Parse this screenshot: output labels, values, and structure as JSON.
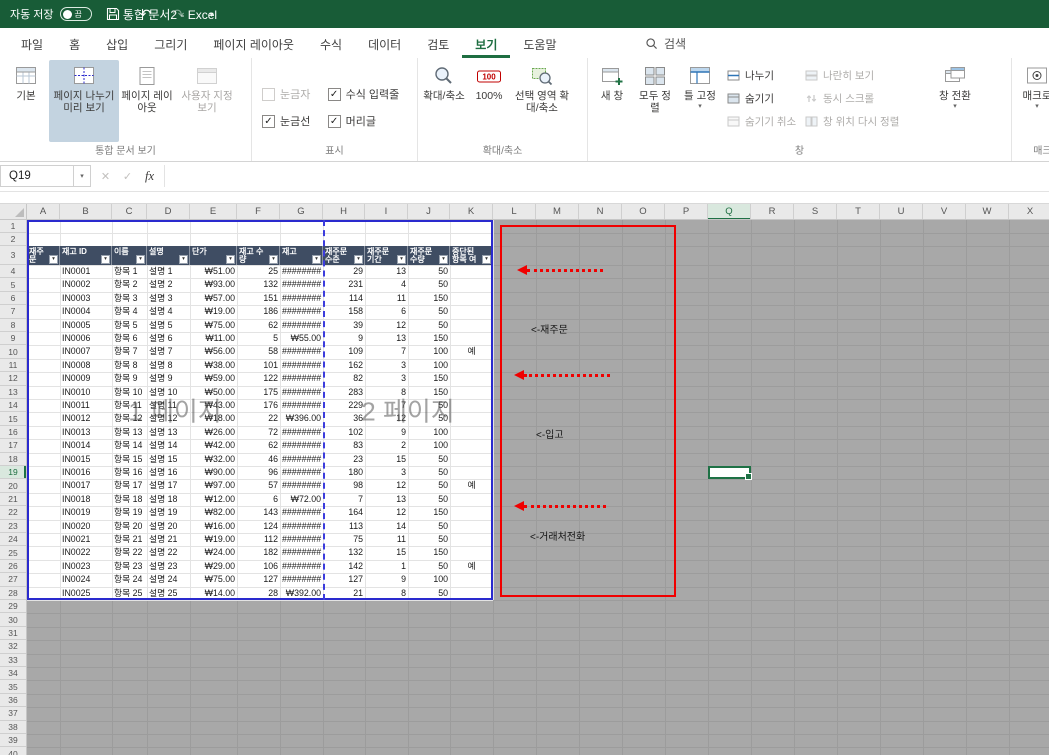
{
  "titlebar": {
    "autosave_label": "자동 저장",
    "autosave_state": "끔",
    "doc_title": "통합 문서2 - Excel"
  },
  "tabs": {
    "items": [
      "파일",
      "홈",
      "삽입",
      "그리기",
      "페이지 레이아웃",
      "수식",
      "데이터",
      "검토",
      "보기",
      "도움말"
    ],
    "active": "보기",
    "search_label": "검색"
  },
  "ribbon": {
    "views": {
      "group_label": "통합 문서 보기",
      "normal": "기본",
      "page_break_preview": "페이지 나누기 미리 보기",
      "page_layout": "페이지 레이아웃",
      "custom_views": "사용자 지정 보기"
    },
    "show": {
      "group_label": "표시",
      "ruler": "눈금자",
      "formula_bar": "수식 입력줄",
      "gridlines": "눈금선",
      "headings": "머리글"
    },
    "zoom": {
      "group_label": "확대/축소",
      "zoom": "확대/축소",
      "hundred": "100%",
      "zoom_selection": "선택 영역 확대/축소"
    },
    "window": {
      "group_label": "창",
      "new_window": "새 창",
      "arrange_all": "모두 정렬",
      "freeze_panes": "틀 고정",
      "split": "나누기",
      "hide": "숨기기",
      "unhide": "숨기기 취소",
      "side_by_side": "나란히 보기",
      "sync_scroll": "동시 스크롤",
      "reset_position": "창 위치 다시 정렬",
      "switch_windows": "창 전환"
    },
    "macros": {
      "group_label": "매크로",
      "macros": "매크로"
    }
  },
  "formula_bar": {
    "name_box": "Q19",
    "fx_label": "fx"
  },
  "sheet": {
    "selected_cell": "Q19",
    "selected_col": "Q",
    "selected_row": 19,
    "col_letters": [
      "A",
      "B",
      "C",
      "D",
      "E",
      "F",
      "G",
      "H",
      "I",
      "J",
      "K",
      "L",
      "M",
      "N",
      "O",
      "P",
      "Q",
      "R",
      "S",
      "T",
      "U",
      "V",
      "W",
      "X"
    ],
    "row_count": 40,
    "watermark_page1": "1 페이지",
    "watermark_page2": "2 페이지",
    "annotations": {
      "reorder": "<-재주문",
      "inbound": "<-입고",
      "vendor_call": "<-거래처전화"
    },
    "table": {
      "headers": [
        "재주문",
        "재고 ID",
        "이름",
        "설명",
        "단가",
        "재고 수량",
        "재고",
        "재주문 수준",
        "재주문 기간",
        "재주문 수량",
        "중단된 항목 여"
      ],
      "rows": [
        [
          "",
          "IN0001",
          "항목 1",
          "설명 1",
          "₩51.00",
          "25",
          "########",
          "29",
          "13",
          "50",
          ""
        ],
        [
          "",
          "IN0002",
          "항목 2",
          "설명 2",
          "₩93.00",
          "132",
          "########",
          "231",
          "4",
          "50",
          ""
        ],
        [
          "",
          "IN0003",
          "항목 3",
          "설명 3",
          "₩57.00",
          "151",
          "########",
          "114",
          "11",
          "150",
          ""
        ],
        [
          "",
          "IN0004",
          "항목 4",
          "설명 4",
          "₩19.00",
          "186",
          "########",
          "158",
          "6",
          "50",
          ""
        ],
        [
          "",
          "IN0005",
          "항목 5",
          "설명 5",
          "₩75.00",
          "62",
          "########",
          "39",
          "12",
          "50",
          ""
        ],
        [
          "",
          "IN0006",
          "항목 6",
          "설명 6",
          "₩11.00",
          "5",
          "₩55.00",
          "9",
          "13",
          "150",
          ""
        ],
        [
          "",
          "IN0007",
          "항목 7",
          "설명 7",
          "₩56.00",
          "58",
          "########",
          "109",
          "7",
          "100",
          "예"
        ],
        [
          "",
          "IN0008",
          "항목 8",
          "설명 8",
          "₩38.00",
          "101",
          "########",
          "162",
          "3",
          "100",
          ""
        ],
        [
          "",
          "IN0009",
          "항목 9",
          "설명 9",
          "₩59.00",
          "122",
          "########",
          "82",
          "3",
          "150",
          ""
        ],
        [
          "",
          "IN0010",
          "항목 10",
          "설명 10",
          "₩50.00",
          "175",
          "########",
          "283",
          "8",
          "150",
          ""
        ],
        [
          "",
          "IN0011",
          "항목 11",
          "설명 11",
          "₩43.00",
          "176",
          "########",
          "229",
          "7",
          "50",
          ""
        ],
        [
          "",
          "IN0012",
          "항목 12",
          "설명 12",
          "₩18.00",
          "22",
          "₩396.00",
          "36",
          "12",
          "50",
          ""
        ],
        [
          "",
          "IN0013",
          "항목 13",
          "설명 13",
          "₩26.00",
          "72",
          "########",
          "102",
          "9",
          "100",
          ""
        ],
        [
          "",
          "IN0014",
          "항목 14",
          "설명 14",
          "₩42.00",
          "62",
          "########",
          "83",
          "2",
          "100",
          ""
        ],
        [
          "",
          "IN0015",
          "항목 15",
          "설명 15",
          "₩32.00",
          "46",
          "########",
          "23",
          "15",
          "50",
          ""
        ],
        [
          "",
          "IN0016",
          "항목 16",
          "설명 16",
          "₩90.00",
          "96",
          "########",
          "180",
          "3",
          "50",
          ""
        ],
        [
          "",
          "IN0017",
          "항목 17",
          "설명 17",
          "₩97.00",
          "57",
          "########",
          "98",
          "12",
          "50",
          "예"
        ],
        [
          "",
          "IN0018",
          "항목 18",
          "설명 18",
          "₩12.00",
          "6",
          "₩72.00",
          "7",
          "13",
          "50",
          ""
        ],
        [
          "",
          "IN0019",
          "항목 19",
          "설명 19",
          "₩82.00",
          "143",
          "########",
          "164",
          "12",
          "150",
          ""
        ],
        [
          "",
          "IN0020",
          "항목 20",
          "설명 20",
          "₩16.00",
          "124",
          "########",
          "113",
          "14",
          "50",
          ""
        ],
        [
          "",
          "IN0021",
          "항목 21",
          "설명 21",
          "₩19.00",
          "112",
          "########",
          "75",
          "11",
          "50",
          ""
        ],
        [
          "",
          "IN0022",
          "항목 22",
          "설명 22",
          "₩24.00",
          "182",
          "########",
          "132",
          "15",
          "150",
          ""
        ],
        [
          "",
          "IN0023",
          "항목 23",
          "설명 23",
          "₩29.00",
          "106",
          "########",
          "142",
          "1",
          "50",
          "예"
        ],
        [
          "",
          "IN0024",
          "항목 24",
          "설명 24",
          "₩75.00",
          "127",
          "########",
          "127",
          "9",
          "100",
          ""
        ],
        [
          "",
          "IN0025",
          "항목 25",
          "설명 25",
          "₩14.00",
          "28",
          "₩392.00",
          "21",
          "8",
          "50",
          ""
        ]
      ]
    }
  }
}
